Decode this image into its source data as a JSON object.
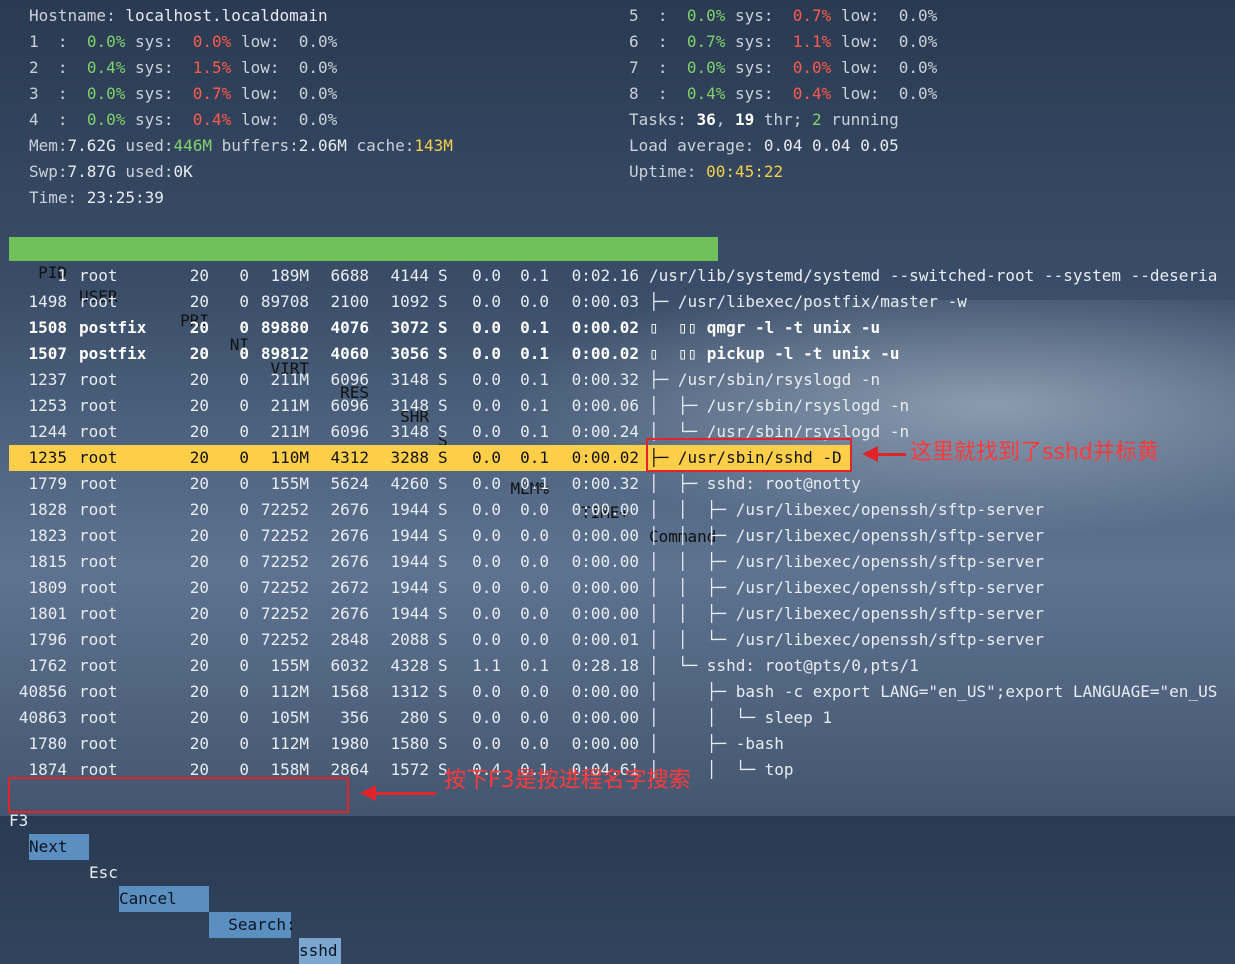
{
  "meters": {
    "hostname_label": "Hostname:",
    "hostname": "localhost.localdomain",
    "cpus_left": [
      {
        "id": "1",
        "user": "0.0%",
        "sys": "0.0%",
        "low": "0.0%"
      },
      {
        "id": "2",
        "user": "0.4%",
        "sys": "1.5%",
        "low": "0.0%"
      },
      {
        "id": "3",
        "user": "0.0%",
        "sys": "0.7%",
        "low": "0.0%"
      },
      {
        "id": "4",
        "user": "0.0%",
        "sys": "0.4%",
        "low": "0.0%"
      }
    ],
    "cpus_right": [
      {
        "id": "5",
        "user": "0.0%",
        "sys": "0.7%",
        "low": "0.0%"
      },
      {
        "id": "6",
        "user": "0.7%",
        "sys": "1.1%",
        "low": "0.0%"
      },
      {
        "id": "7",
        "user": "0.0%",
        "sys": "0.0%",
        "low": "0.0%"
      },
      {
        "id": "8",
        "user": "0.4%",
        "sys": "0.4%",
        "low": "0.0%"
      }
    ],
    "mem_label": "Mem:",
    "mem_total": "7.62G",
    "mem_used_label": " used:",
    "mem_used": "446M",
    "buffers_label": " buffers:",
    "buffers": "2.06M",
    "cache_label": " cache:",
    "cache": "143M",
    "swp_label": "Swp:",
    "swp_total": "7.87G",
    "swp_used_label": " used:",
    "swp_used": "0K",
    "time_label": "Time: ",
    "time": "23:25:39",
    "tasks_label": "Tasks: ",
    "tasks": "36",
    "thr": "19",
    "thr_label": " thr; ",
    "running": "2",
    "running_label": " running",
    "load_label": "Load average: ",
    "load": "0.04 0.04 0.05",
    "uptime_label": "Uptime: ",
    "uptime": "00:45:22"
  },
  "columns": [
    "PID",
    "USER",
    "PRI",
    "NI",
    "VIRT",
    "RES",
    "SHR",
    "S",
    "CPU%",
    "MEM%",
    "TIME+",
    "Command"
  ],
  "processes": [
    {
      "pid": "1",
      "user": "root",
      "pri": "20",
      "ni": "0",
      "virt": "189M",
      "res": "6688",
      "shr": "4144",
      "s": "S",
      "cpu": "0.0",
      "mem": "0.1",
      "time": "0:02.16",
      "cmd": "/usr/lib/systemd/systemd --switched-root --system --deseria",
      "style": "normal"
    },
    {
      "pid": "1498",
      "user": "root",
      "pri": "20",
      "ni": "0",
      "virt": "89708",
      "res": "2100",
      "shr": "1092",
      "s": "S",
      "cpu": "0.0",
      "mem": "0.0",
      "time": "0:00.03",
      "cmd": "├─ /usr/libexec/postfix/master -w",
      "style": "normal"
    },
    {
      "pid": "1508",
      "user": "postfix",
      "pri": "20",
      "ni": "0",
      "virt": "89880",
      "res": "4076",
      "shr": "3072",
      "s": "S",
      "cpu": "0.0",
      "mem": "0.1",
      "time": "0:00.02",
      "cmd": "▯  ▯▯ qmgr -l -t unix -u",
      "style": "bold"
    },
    {
      "pid": "1507",
      "user": "postfix",
      "pri": "20",
      "ni": "0",
      "virt": "89812",
      "res": "4060",
      "shr": "3056",
      "s": "S",
      "cpu": "0.0",
      "mem": "0.1",
      "time": "0:00.02",
      "cmd": "▯  ▯▯ pickup -l -t unix -u",
      "style": "bold"
    },
    {
      "pid": "1237",
      "user": "root",
      "pri": "20",
      "ni": "0",
      "virt": "211M",
      "res": "6096",
      "shr": "3148",
      "s": "S",
      "cpu": "0.0",
      "mem": "0.1",
      "time": "0:00.32",
      "cmd": "├─ /usr/sbin/rsyslogd -n",
      "style": "normal"
    },
    {
      "pid": "1253",
      "user": "root",
      "pri": "20",
      "ni": "0",
      "virt": "211M",
      "res": "6096",
      "shr": "3148",
      "s": "S",
      "cpu": "0.0",
      "mem": "0.1",
      "time": "0:00.06",
      "cmd": "│  ├─ /usr/sbin/rsyslogd -n",
      "style": "normal"
    },
    {
      "pid": "1244",
      "user": "root",
      "pri": "20",
      "ni": "0",
      "virt": "211M",
      "res": "6096",
      "shr": "3148",
      "s": "S",
      "cpu": "0.0",
      "mem": "0.1",
      "time": "0:00.24",
      "cmd": "│  └─ /usr/sbin/rsyslogd -n",
      "style": "normal"
    },
    {
      "pid": "1235",
      "user": "root",
      "pri": "20",
      "ni": "0",
      "virt": "110M",
      "res": "4312",
      "shr": "3288",
      "s": "S",
      "cpu": "0.0",
      "mem": "0.1",
      "time": "0:00.02",
      "cmd": "├─ /usr/sbin/sshd -D",
      "style": "highlight"
    },
    {
      "pid": "1779",
      "user": "root",
      "pri": "20",
      "ni": "0",
      "virt": "155M",
      "res": "5624",
      "shr": "4260",
      "s": "S",
      "cpu": "0.0",
      "mem": "0.1",
      "time": "0:00.32",
      "cmd": "│  ├─ sshd: root@notty",
      "style": "normal"
    },
    {
      "pid": "1828",
      "user": "root",
      "pri": "20",
      "ni": "0",
      "virt": "72252",
      "res": "2676",
      "shr": "1944",
      "s": "S",
      "cpu": "0.0",
      "mem": "0.0",
      "time": "0:00.00",
      "cmd": "│  │  ├─ /usr/libexec/openssh/sftp-server",
      "style": "normal"
    },
    {
      "pid": "1823",
      "user": "root",
      "pri": "20",
      "ni": "0",
      "virt": "72252",
      "res": "2676",
      "shr": "1944",
      "s": "S",
      "cpu": "0.0",
      "mem": "0.0",
      "time": "0:00.00",
      "cmd": "│  │  ├─ /usr/libexec/openssh/sftp-server",
      "style": "normal"
    },
    {
      "pid": "1815",
      "user": "root",
      "pri": "20",
      "ni": "0",
      "virt": "72252",
      "res": "2676",
      "shr": "1944",
      "s": "S",
      "cpu": "0.0",
      "mem": "0.0",
      "time": "0:00.00",
      "cmd": "│  │  ├─ /usr/libexec/openssh/sftp-server",
      "style": "normal"
    },
    {
      "pid": "1809",
      "user": "root",
      "pri": "20",
      "ni": "0",
      "virt": "72252",
      "res": "2672",
      "shr": "1944",
      "s": "S",
      "cpu": "0.0",
      "mem": "0.0",
      "time": "0:00.00",
      "cmd": "│  │  ├─ /usr/libexec/openssh/sftp-server",
      "style": "normal"
    },
    {
      "pid": "1801",
      "user": "root",
      "pri": "20",
      "ni": "0",
      "virt": "72252",
      "res": "2676",
      "shr": "1944",
      "s": "S",
      "cpu": "0.0",
      "mem": "0.0",
      "time": "0:00.00",
      "cmd": "│  │  ├─ /usr/libexec/openssh/sftp-server",
      "style": "normal"
    },
    {
      "pid": "1796",
      "user": "root",
      "pri": "20",
      "ni": "0",
      "virt": "72252",
      "res": "2848",
      "shr": "2088",
      "s": "S",
      "cpu": "0.0",
      "mem": "0.0",
      "time": "0:00.01",
      "cmd": "│  │  └─ /usr/libexec/openssh/sftp-server",
      "style": "normal"
    },
    {
      "pid": "1762",
      "user": "root",
      "pri": "20",
      "ni": "0",
      "virt": "155M",
      "res": "6032",
      "shr": "4328",
      "s": "S",
      "cpu": "1.1",
      "mem": "0.1",
      "time": "0:28.18",
      "cmd": "│  └─ sshd: root@pts/0,pts/1",
      "style": "normal"
    },
    {
      "pid": "40856",
      "user": "root",
      "pri": "20",
      "ni": "0",
      "virt": "112M",
      "res": "1568",
      "shr": "1312",
      "s": "S",
      "cpu": "0.0",
      "mem": "0.0",
      "time": "0:00.00",
      "cmd": "│     ├─ bash -c export LANG=\"en_US\";export LANGUAGE=\"en_US",
      "style": "normal"
    },
    {
      "pid": "40863",
      "user": "root",
      "pri": "20",
      "ni": "0",
      "virt": "105M",
      "res": "356",
      "shr": "280",
      "s": "S",
      "cpu": "0.0",
      "mem": "0.0",
      "time": "0:00.00",
      "cmd": "│     │  └─ sleep 1",
      "style": "normal"
    },
    {
      "pid": "1780",
      "user": "root",
      "pri": "20",
      "ni": "0",
      "virt": "112M",
      "res": "1980",
      "shr": "1580",
      "s": "S",
      "cpu": "0.0",
      "mem": "0.0",
      "time": "0:00.00",
      "cmd": "│     ├─ -bash",
      "style": "normal"
    },
    {
      "pid": "1874",
      "user": "root",
      "pri": "20",
      "ni": "0",
      "virt": "158M",
      "res": "2864",
      "shr": "1572",
      "s": "S",
      "cpu": "0.4",
      "mem": "0.1",
      "time": "0:04.61",
      "cmd": "│     │  └─ top",
      "style": "normal"
    }
  ],
  "footer": {
    "f3_key": "F3",
    "f3_label": "Next  ",
    "esc_key": "Esc",
    "esc_label": "Cancel  ",
    "search_label": "  Search: ",
    "search_value": "sshd"
  },
  "annotations": {
    "highlight_note": "这里就找到了sshd并标黄",
    "search_note": "按下F3是按进程名字搜索"
  },
  "colors": {
    "highlight": "#ffcf4a",
    "header": "#6fbf5a",
    "footer_label": "#5b8fc0",
    "annotation": "#e0242a"
  }
}
